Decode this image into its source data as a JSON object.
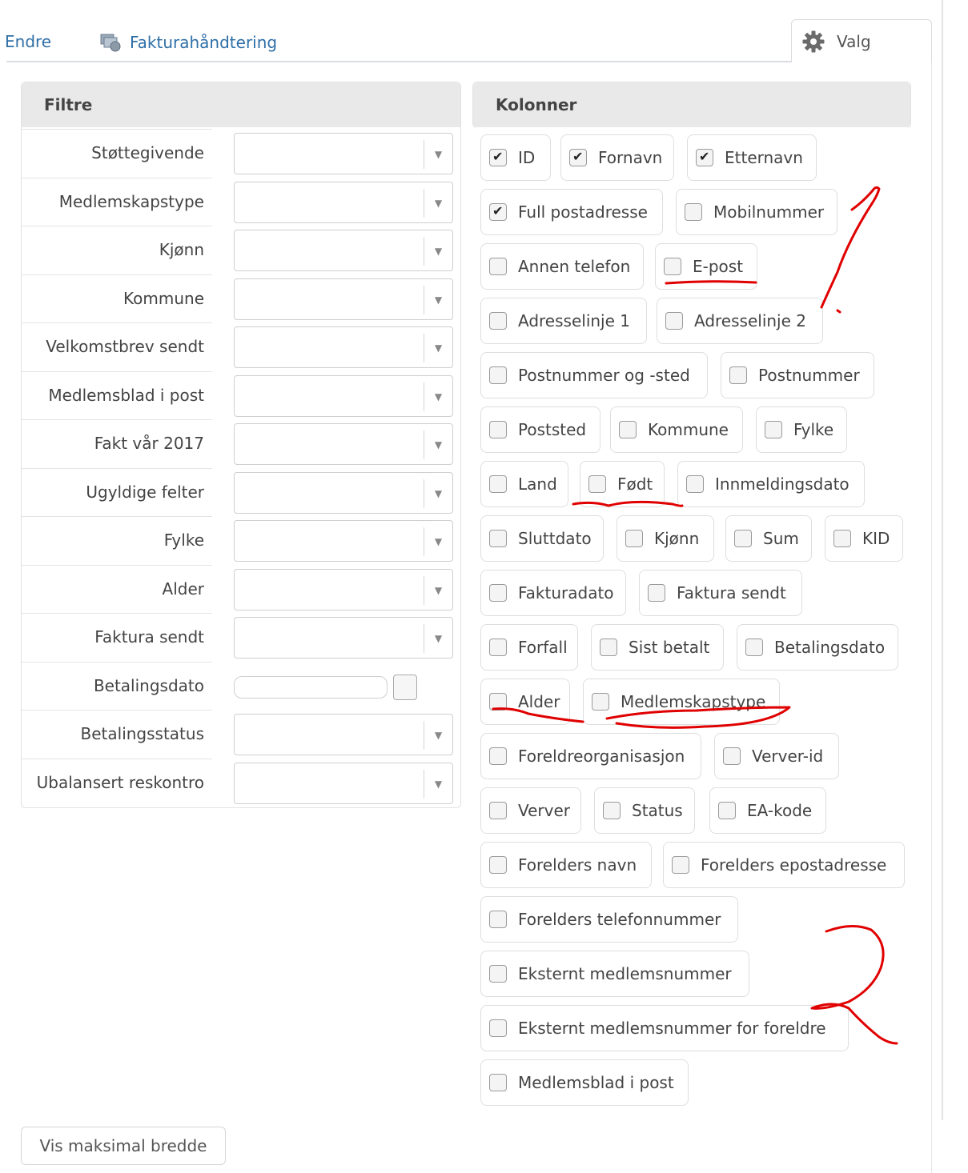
{
  "toolbar": {
    "edit_link": "Endre",
    "invoice_link": "Fakturahåndtering",
    "options_tab": "Valg"
  },
  "filters": {
    "title": "Filtre",
    "rows": [
      {
        "label": "Støttegivende",
        "type": "select"
      },
      {
        "label": "Medlemskapstype",
        "type": "select"
      },
      {
        "label": "Kjønn",
        "type": "select"
      },
      {
        "label": "Kommune",
        "type": "select"
      },
      {
        "label": "Velkomstbrev sendt",
        "type": "select"
      },
      {
        "label": "Medlemsblad i post",
        "type": "select"
      },
      {
        "label": "Fakt vår 2017",
        "type": "select"
      },
      {
        "label": "Ugyldige felter",
        "type": "select"
      },
      {
        "label": "Fylke",
        "type": "select"
      },
      {
        "label": "Alder",
        "type": "select"
      },
      {
        "label": "Faktura sendt",
        "type": "select"
      },
      {
        "label": "Betalingsdato",
        "type": "date"
      },
      {
        "label": "Betalingsstatus",
        "type": "select"
      },
      {
        "label": "Ubalansert reskontro",
        "type": "select"
      }
    ]
  },
  "columns": {
    "title": "Kolonner",
    "items": [
      {
        "label": "ID",
        "checked": true
      },
      {
        "label": "Fornavn",
        "checked": true
      },
      {
        "label": "Etternavn",
        "checked": true
      },
      {
        "label": "Full postadresse",
        "checked": true
      },
      {
        "label": "Mobilnummer",
        "checked": false
      },
      {
        "label": "Annen telefon",
        "checked": false
      },
      {
        "label": "E-post",
        "checked": false
      },
      {
        "label": "Adresselinje 1",
        "checked": false
      },
      {
        "label": "Adresselinje 2",
        "checked": false
      },
      {
        "label": "Postnummer og -sted",
        "checked": false
      },
      {
        "label": "Postnummer",
        "checked": false
      },
      {
        "label": "Poststed",
        "checked": false
      },
      {
        "label": "Kommune",
        "checked": false
      },
      {
        "label": "Fylke",
        "checked": false
      },
      {
        "label": "Land",
        "checked": false
      },
      {
        "label": "Født",
        "checked": false
      },
      {
        "label": "Innmeldingsdato",
        "checked": false
      },
      {
        "label": "Sluttdato",
        "checked": false
      },
      {
        "label": "Kjønn",
        "checked": false
      },
      {
        "label": "Sum",
        "checked": false
      },
      {
        "label": "KID",
        "checked": false
      },
      {
        "label": "Fakturadato",
        "checked": false
      },
      {
        "label": "Faktura sendt",
        "checked": false
      },
      {
        "label": "Forfall",
        "checked": false
      },
      {
        "label": "Sist betalt",
        "checked": false
      },
      {
        "label": "Betalingsdato",
        "checked": false
      },
      {
        "label": "Alder",
        "checked": false
      },
      {
        "label": "Medlemskapstype",
        "checked": false
      },
      {
        "label": "Foreldreorganisasjon",
        "checked": false
      },
      {
        "label": "Verver-id",
        "checked": false
      },
      {
        "label": "Verver",
        "checked": false
      },
      {
        "label": "Status",
        "checked": false
      },
      {
        "label": "EA-kode",
        "checked": false
      },
      {
        "label": "Forelders navn",
        "checked": false
      },
      {
        "label": "Forelders epostadresse",
        "checked": false
      },
      {
        "label": "Forelders telefonnummer",
        "checked": false
      },
      {
        "label": "Eksternt medlemsnummer",
        "checked": false
      },
      {
        "label": "Eksternt medlemsnummer for foreldre",
        "checked": false
      },
      {
        "label": "Medlemsblad i post",
        "checked": false
      }
    ]
  },
  "footer": {
    "max_width_button": "Vis maksimal bredde"
  },
  "annotation_color": "#e00000"
}
